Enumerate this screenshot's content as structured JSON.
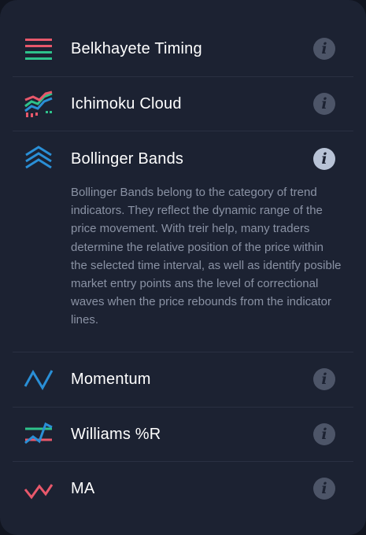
{
  "indicators": [
    {
      "name": "Belkhayete Timing",
      "icon": "belkhayete-timing-icon",
      "info_icon": "i"
    },
    {
      "name": "Ichimoku Cloud",
      "icon": "ichimoku-cloud-icon",
      "info_icon": "i"
    },
    {
      "name": "Bollinger Bands",
      "icon": "bollinger-bands-icon",
      "info_icon": "i",
      "expanded": true,
      "description": "Bollinger Bands belong to the category of trend indicators. They reflect the dynamic range of the price movement. With treir help, many traders determine the relative position of the price within the selected time interval, as well as identify posible market entry points ans the level of correctional waves when the price rebounds from the indicator lines."
    },
    {
      "name": "Momentum",
      "icon": "momentum-icon",
      "info_icon": "i"
    },
    {
      "name": "Williams %R",
      "icon": "williams-r-icon",
      "info_icon": "i"
    },
    {
      "name": "MA",
      "icon": "ma-icon",
      "info_icon": "i"
    }
  ],
  "colors": {
    "background": "#1c2232",
    "text": "#ffffff",
    "description_text": "#8a92a4",
    "pink": "#e8586b",
    "green": "#2ec28b",
    "blue": "#2a8fd6",
    "info_inactive": "#4d5568",
    "info_active": "#b8c3d6"
  }
}
